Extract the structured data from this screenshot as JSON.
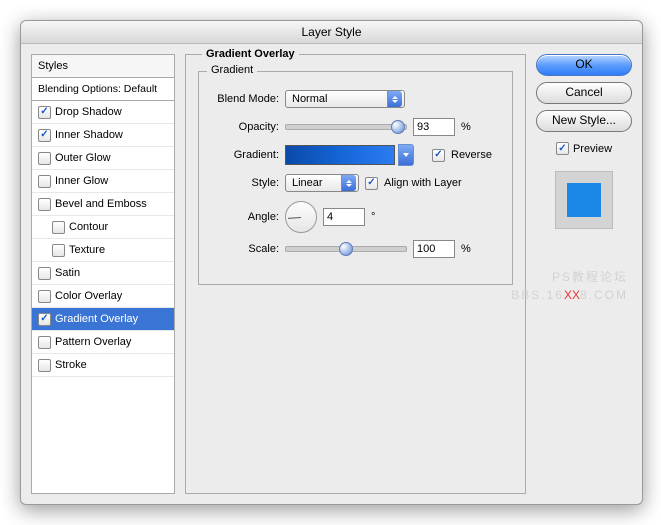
{
  "window": {
    "title": "Layer Style"
  },
  "styles_panel": {
    "header": "Styles",
    "blending": "Blending Options: Default",
    "items": [
      {
        "label": "Drop Shadow",
        "checked": true,
        "indent": false
      },
      {
        "label": "Inner Shadow",
        "checked": true,
        "indent": false
      },
      {
        "label": "Outer Glow",
        "checked": false,
        "indent": false
      },
      {
        "label": "Inner Glow",
        "checked": false,
        "indent": false
      },
      {
        "label": "Bevel and Emboss",
        "checked": false,
        "indent": false
      },
      {
        "label": "Contour",
        "checked": false,
        "indent": true
      },
      {
        "label": "Texture",
        "checked": false,
        "indent": true
      },
      {
        "label": "Satin",
        "checked": false,
        "indent": false
      },
      {
        "label": "Color Overlay",
        "checked": false,
        "indent": false
      },
      {
        "label": "Gradient Overlay",
        "checked": true,
        "indent": false,
        "selected": true
      },
      {
        "label": "Pattern Overlay",
        "checked": false,
        "indent": false
      },
      {
        "label": "Stroke",
        "checked": false,
        "indent": false
      }
    ]
  },
  "gradient_overlay": {
    "title": "Gradient Overlay",
    "subtitle": "Gradient",
    "blend_label": "Blend Mode:",
    "blend_value": "Normal",
    "opacity_label": "Opacity:",
    "opacity_value": "93",
    "opacity_unit": "%",
    "gradient_label": "Gradient:",
    "reverse_label": "Reverse",
    "reverse_checked": true,
    "style_label": "Style:",
    "style_value": "Linear",
    "align_label": "Align with Layer",
    "align_checked": true,
    "angle_label": "Angle:",
    "angle_value": "4",
    "angle_unit": "°",
    "scale_label": "Scale:",
    "scale_value": "100",
    "scale_unit": "%"
  },
  "buttons": {
    "ok": "OK",
    "cancel": "Cancel",
    "new_style": "New Style...",
    "preview": "Preview"
  },
  "watermark": {
    "line1": "PS教程论坛",
    "line2a": "BBS.16",
    "line2b": "XX",
    "line2c": "8.COM"
  }
}
